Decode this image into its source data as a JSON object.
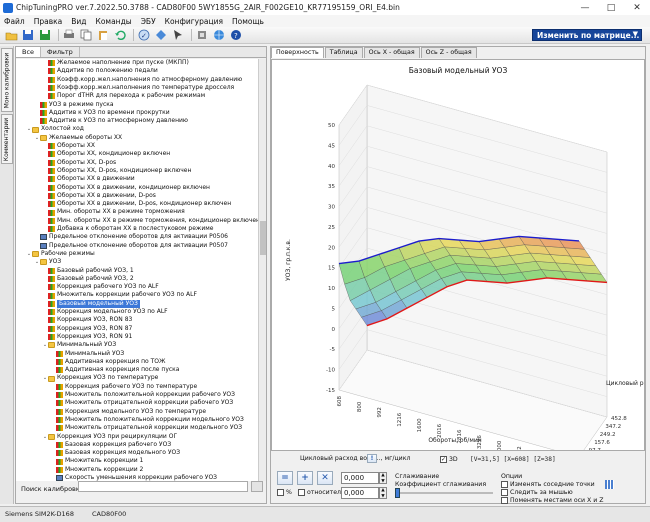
{
  "window": {
    "title": "ChipTuningPRO ver.7.2022.50.3788 - CAD80F00 5WY1855G_2AIR_F002GE10_KR77195159_ORI_E4.bin",
    "minimize_glyph": "—",
    "maximize_glyph": "□",
    "close_glyph": "✕"
  },
  "menu": [
    "Файл",
    "Правка",
    "Вид",
    "Команды",
    "ЭБУ",
    "Конфигурация",
    "Помощь"
  ],
  "toolbar": {
    "icons": [
      "open-icon",
      "save-icon",
      "save-as-icon",
      "print-icon",
      "copy-icon",
      "paste-icon",
      "undo-icon",
      "checksum-icon",
      "compare-icon",
      "cursor-icon",
      "settings-icon",
      "globe-icon",
      "help-icon"
    ],
    "matrix_select": "Изменить по матрице..."
  },
  "sidebar": {
    "tab1": "Моно калибровки",
    "tab2": "Комментарии"
  },
  "tree": {
    "tabs": [
      "Все",
      "Фильтр"
    ],
    "selected": "Базовый модельный УОЗ",
    "search_label": "Поиск калибровки",
    "rows": [
      {
        "level": 4,
        "icon": "chart",
        "text": "Желаемое наполнение при пуске (МКПП)"
      },
      {
        "level": 4,
        "icon": "chart",
        "text": "Аддитив по положению педали"
      },
      {
        "level": 4,
        "icon": "chart",
        "text": "Коэфф.корр.жел.наполнения по атмосферному давлению"
      },
      {
        "level": 4,
        "icon": "chart",
        "text": "Коэфф.корр.жел.наполнения по температуре дросселя"
      },
      {
        "level": 4,
        "icon": "chart",
        "text": "Порог dTHR для перехода к рабочим режимам"
      },
      {
        "level": 3,
        "icon": "chart",
        "text": "УОЗ в режиме пуска"
      },
      {
        "level": 3,
        "icon": "chart",
        "text": "Аддитив к УОЗ по времени прокрутки"
      },
      {
        "level": 3,
        "icon": "chart",
        "text": "Аддитив к УОЗ по атмосферному давлению"
      },
      {
        "level": 2,
        "icon": "folder",
        "exp": "⌄",
        "text": "Холостой ход"
      },
      {
        "level": 3,
        "icon": "folder",
        "exp": "⌄",
        "text": "Желаемые обороты XX"
      },
      {
        "level": 4,
        "icon": "chart",
        "text": "Обороты XX"
      },
      {
        "level": 4,
        "icon": "chart",
        "text": "Обороты XX, кондиционер включен"
      },
      {
        "level": 4,
        "icon": "chart",
        "text": "Обороты XX, D-pos"
      },
      {
        "level": 4,
        "icon": "chart",
        "text": "Обороты XX, D-pos, кондиционер включен"
      },
      {
        "level": 4,
        "icon": "chart",
        "text": "Обороты XX в движении"
      },
      {
        "level": 4,
        "icon": "chart",
        "text": "Обороты XX в движении, кондиционер включен"
      },
      {
        "level": 4,
        "icon": "chart",
        "text": "Обороты XX в движении, D-pos"
      },
      {
        "level": 4,
        "icon": "chart",
        "text": "Обороты XX в движении, D-pos, кондиционер включен"
      },
      {
        "level": 4,
        "icon": "chart",
        "text": "Мин. обороты XX в режиме торможения"
      },
      {
        "level": 4,
        "icon": "chart",
        "text": "Мин. обороты XX в режиме торможения, кондиционер включен"
      },
      {
        "level": 4,
        "icon": "chart",
        "text": "Добавка к оборотам XX в послестуковом режиме"
      },
      {
        "level": 3,
        "icon": "num",
        "text": "Предельное отклонение оборотов для активации P0506"
      },
      {
        "level": 3,
        "icon": "num",
        "text": "Предельное отклонение оборотов для активации P0507"
      },
      {
        "level": 2,
        "icon": "folder",
        "exp": "⌄",
        "text": "Рабочие режимы"
      },
      {
        "level": 3,
        "icon": "folder",
        "exp": "⌄",
        "text": "УОЗ"
      },
      {
        "level": 4,
        "icon": "chart",
        "text": "Базовый рабочий УОЗ, 1"
      },
      {
        "level": 4,
        "icon": "chart",
        "text": "Базовый рабочий УОЗ, 2"
      },
      {
        "level": 4,
        "icon": "chart",
        "text": "Коррекция рабочего УОЗ по ALF"
      },
      {
        "level": 4,
        "icon": "chart",
        "text": "Множитель коррекции рабочего УОЗ по ALF"
      },
      {
        "level": 4,
        "icon": "chart",
        "text": "Базовый модельный УОЗ",
        "sel": true
      },
      {
        "level": 4,
        "icon": "chart",
        "text": "Коррекция модельного УОЗ по ALF"
      },
      {
        "level": 4,
        "icon": "chart",
        "text": "Коррекция УОЗ, RON 83"
      },
      {
        "level": 4,
        "icon": "chart",
        "text": "Коррекция УОЗ, RON 87"
      },
      {
        "level": 4,
        "icon": "chart",
        "text": "Коррекция УОЗ, RON 91"
      },
      {
        "level": 4,
        "icon": "folder",
        "exp": "⌄",
        "text": "Минимальный УОЗ"
      },
      {
        "level": 5,
        "icon": "chart",
        "text": "Минимальный УОЗ"
      },
      {
        "level": 5,
        "icon": "chart",
        "text": "Аддитивная коррекция по ТОЖ"
      },
      {
        "level": 5,
        "icon": "chart",
        "text": "Аддитивная коррекция после пуска"
      },
      {
        "level": 4,
        "icon": "folder",
        "exp": "⌄",
        "text": "Коррекция УОЗ по температуре"
      },
      {
        "level": 5,
        "icon": "chart",
        "text": "Коррекция рабочего УОЗ по температуре"
      },
      {
        "level": 5,
        "icon": "chart",
        "text": "Множитель положительной коррекции рабочего УОЗ"
      },
      {
        "level": 5,
        "icon": "chart",
        "text": "Множитель отрицательной коррекции рабочего УОЗ"
      },
      {
        "level": 5,
        "icon": "chart",
        "text": "Коррекция модельного УОЗ по температуре"
      },
      {
        "level": 5,
        "icon": "chart",
        "text": "Множитель положительной коррекции модельного УОЗ"
      },
      {
        "level": 5,
        "icon": "chart",
        "text": "Множитель отрицательной коррекции модельного УОЗ"
      },
      {
        "level": 4,
        "icon": "folder",
        "exp": "⌄",
        "text": "Коррекция УОЗ при рециркуляции ОГ"
      },
      {
        "level": 5,
        "icon": "chart",
        "text": "Базовая коррекция рабочего УОЗ"
      },
      {
        "level": 5,
        "icon": "chart",
        "text": "Базовая коррекция модельного УОЗ"
      },
      {
        "level": 5,
        "icon": "chart",
        "text": "Множитель коррекции 1"
      },
      {
        "level": 5,
        "icon": "chart",
        "text": "Множитель коррекции 2"
      },
      {
        "level": 5,
        "icon": "num",
        "text": "Скорость уменьшения коррекции рабочего УОЗ"
      }
    ]
  },
  "view_tabs": [
    "Поверхность",
    "Таблица",
    "Ось X - общая",
    "Ось Z - общая"
  ],
  "chart": {
    "title": "Базовый модельный УОЗ",
    "ylabel": "УОЗ, гр.п.к.в.",
    "xlabel": "Обороты, об/мин",
    "zlabel": "Цикловый расход",
    "yticks": [
      "50",
      "45",
      "40",
      "35",
      "30",
      "25",
      "20",
      "15",
      "10",
      "5",
      "0",
      "-5",
      "-10",
      "-15"
    ],
    "xticks": [
      "608",
      "800",
      "992",
      "1216",
      "1600",
      "2016",
      "2816",
      "3296",
      "4000",
      "4512",
      "4800",
      "5216",
      "6016"
    ],
    "zticks": [
      "97.7",
      "157.6",
      "249.2",
      "347.2",
      "452.8"
    ],
    "z_tick_38": "38"
  },
  "chart_data": {
    "type": "heatmap",
    "title": "Базовый модельный УОЗ",
    "xlabel": "Обороты, об/мин",
    "ylabel": "УОЗ, гр.п.к.в.",
    "zlabel": "Цикловый расход",
    "ylim": [
      -15,
      50
    ],
    "x_ticks": [
      608,
      800,
      992,
      1216,
      1600,
      2016,
      2816,
      3296,
      4000,
      4512,
      4800,
      5216,
      6016
    ],
    "z_ticks": [
      38,
      97.7,
      157.6,
      249.2,
      347.2,
      452.8
    ],
    "surface_z": [
      [
        16,
        18,
        21,
        24,
        27,
        29,
        30,
        31,
        33,
        35,
        36,
        37,
        38
      ],
      [
        9,
        12,
        16,
        19,
        22,
        25,
        26,
        27,
        29,
        31,
        32,
        33,
        34
      ],
      [
        3,
        7,
        11,
        15,
        18,
        21,
        22,
        23,
        25,
        27,
        28,
        29,
        30
      ],
      [
        -1,
        2,
        6,
        10,
        14,
        17,
        18,
        19,
        21,
        23,
        24,
        25,
        26
      ],
      [
        -5,
        -2,
        2,
        6,
        10,
        13,
        14,
        15,
        17,
        19,
        20,
        21,
        22
      ],
      [
        -9,
        -6,
        -2,
        2,
        6,
        9,
        10,
        11,
        13,
        15,
        16,
        17,
        18
      ]
    ]
  },
  "controls": {
    "smoothing_label": "Цикловый расход возд..., мг/цикл",
    "value_label": "[V=31,5] [X=608] [Z=38]",
    "cb_3d": "3D",
    "cb_percent": "%",
    "cb_relative": "относительно",
    "input1": "0,000",
    "input2": "0,000",
    "smoothing_title": "Сглаживание",
    "smoothing_coef": "Коэффициент сглаживания",
    "options_title": "Опции",
    "opt1": "Изменять соседние точки",
    "opt2": "Следить за мышью",
    "opt3": "Поменять местами оси X и Z",
    "btn_equal": "=",
    "btn_plus": "+",
    "btn_minus": "✕"
  },
  "status": {
    "ecu": "Siemens SIM2K-D168",
    "file": "CAD80F00"
  }
}
